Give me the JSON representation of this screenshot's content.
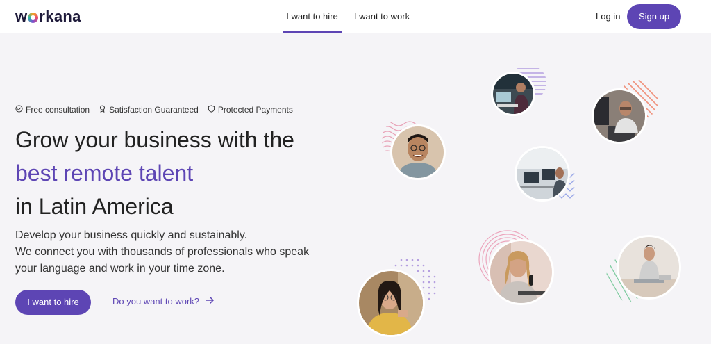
{
  "brand": {
    "logo_before": "w",
    "logo_after": "rkana",
    "accent": "#5d45b4"
  },
  "nav": {
    "tabs": [
      {
        "label": "I want to hire",
        "active": true
      },
      {
        "label": "I want to work",
        "active": false
      }
    ],
    "login_label": "Log in",
    "signup_label": "Sign up"
  },
  "hero": {
    "badges": [
      {
        "icon": "check-circle-icon",
        "label": "Free consultation"
      },
      {
        "icon": "award-icon",
        "label": "Satisfaction Guaranteed"
      },
      {
        "icon": "shield-icon",
        "label": "Protected Payments"
      }
    ],
    "headline_line1": "Grow your business with the",
    "headline_line2": "best remote talent",
    "headline_line3": "in Latin America",
    "subtitle_line1": "Develop your business quickly and sustainably.",
    "subtitle_line2": "We connect you with thousands of professionals who speak",
    "subtitle_line3": "your language and work in your time zone.",
    "cta_label": "I want to hire",
    "secondary_link": "Do you want to work?"
  },
  "gallery": [
    {
      "name": "freelancer-photo-desk-laptop",
      "bg": "#3d4a52"
    },
    {
      "name": "freelancer-photo-man-glasses-smiling",
      "bg": "#c9a98a"
    },
    {
      "name": "freelancer-photo-man-monitor",
      "bg": "#8a7f77"
    },
    {
      "name": "freelancer-photo-man-workstation",
      "bg": "#b9c1c9"
    },
    {
      "name": "freelancer-photo-woman-microphone",
      "bg": "#c7a69a"
    },
    {
      "name": "freelancer-photo-woman-floor-laptop",
      "bg": "#d9d2cc"
    },
    {
      "name": "freelancer-photo-woman-glasses-reading",
      "bg": "#9b7c5c"
    }
  ]
}
